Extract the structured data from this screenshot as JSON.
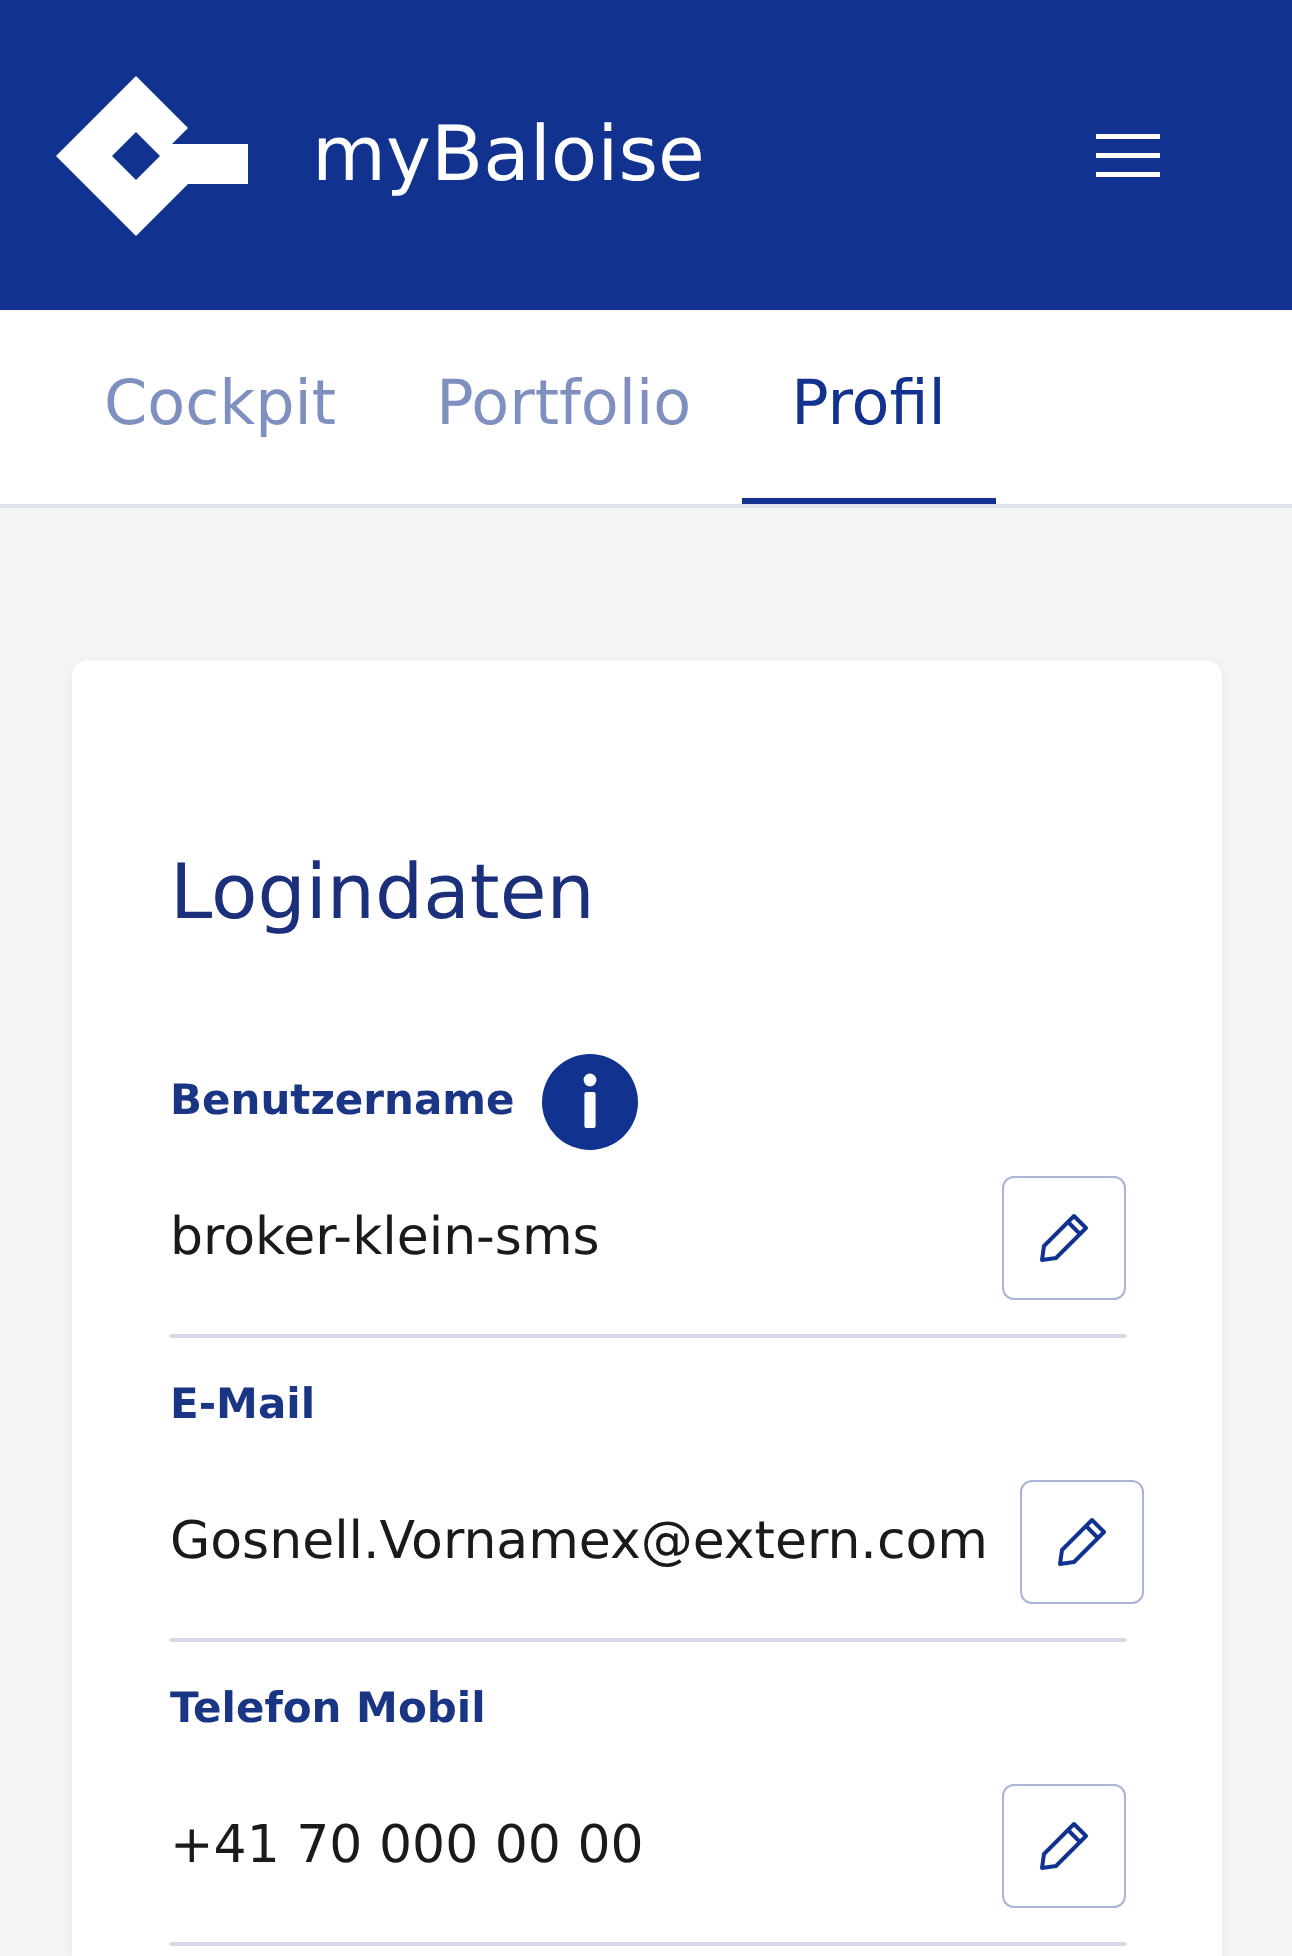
{
  "header": {
    "brand": "myBaloise"
  },
  "tabs": [
    {
      "label": "Cockpit",
      "selected": false
    },
    {
      "label": "Portfolio",
      "selected": false
    },
    {
      "label": "Profil",
      "selected": true
    }
  ],
  "card": {
    "title": "Logindaten",
    "fields": [
      {
        "label": "Benutzername",
        "info": true,
        "value": "broker-klein-sms"
      },
      {
        "label": "E-Mail",
        "info": false,
        "value": "Gosnell.Vornamex@extern.com"
      },
      {
        "label": "Telefon Mobil",
        "info": false,
        "value": "+41 70 000 00 00"
      }
    ]
  }
}
